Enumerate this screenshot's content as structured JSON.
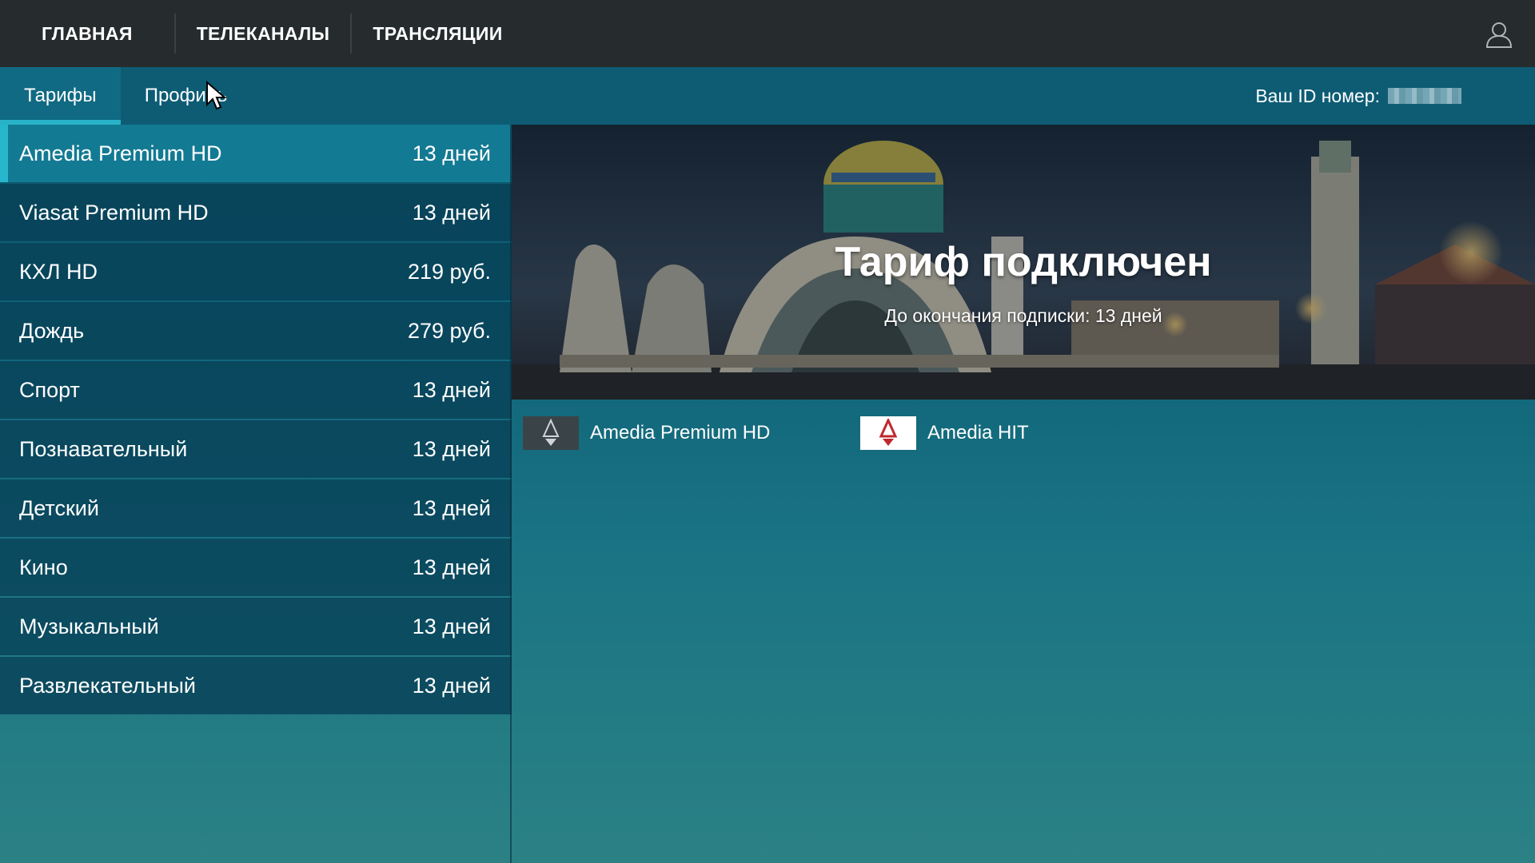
{
  "nav": {
    "items": [
      {
        "label": "ГЛАВНАЯ"
      },
      {
        "label": "ТЕЛЕКАНАЛЫ"
      },
      {
        "label": "ТРАНСЛЯЦИИ"
      }
    ],
    "user_icon": "user-icon"
  },
  "subnav": {
    "tabs": [
      {
        "label": "Тарифы",
        "active": true
      },
      {
        "label": "Профиль",
        "active": false
      }
    ],
    "id_label": "Ваш ID номер:"
  },
  "tariffs": [
    {
      "name": "Amedia Premium HD",
      "price": "13 дней",
      "selected": true
    },
    {
      "name": "Viasat Premium HD",
      "price": "13 дней"
    },
    {
      "name": "КХЛ HD",
      "price": "219 руб."
    },
    {
      "name": "Дождь",
      "price": "279 руб."
    },
    {
      "name": "Спорт",
      "price": "13 дней"
    },
    {
      "name": "Познавательный",
      "price": "13 дней"
    },
    {
      "name": "Детский",
      "price": "13 дней"
    },
    {
      "name": "Кино",
      "price": "13 дней"
    },
    {
      "name": "Музыкальный",
      "price": "13 дней"
    },
    {
      "name": "Развлекательный",
      "price": "13 дней"
    }
  ],
  "banner": {
    "title": "Тариф подключен",
    "subtitle": "До окончания подписки: 13 дней"
  },
  "channels": [
    {
      "name": "Amedia Premium HD",
      "logo": "amedia-premium-logo"
    },
    {
      "name": "Amedia HIT",
      "logo": "amedia-hit-logo"
    }
  ],
  "colors": {
    "topbar": "#262c2e",
    "accent": "#27b7cc",
    "selected_row": "#137a93"
  }
}
